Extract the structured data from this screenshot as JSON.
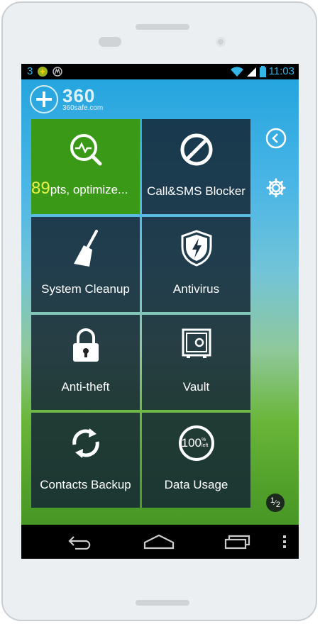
{
  "status_bar": {
    "notification_count": "3",
    "time": "11:03"
  },
  "logo": {
    "number": "360",
    "site": "360safe.com"
  },
  "tiles": [
    {
      "score": "89",
      "label_suffix": "pts, optimize..."
    },
    {
      "label": "Call&SMS Blocker"
    },
    {
      "label": "System Cleanup"
    },
    {
      "label": "Antivirus"
    },
    {
      "label": "Anti-theft"
    },
    {
      "label": "Vault"
    },
    {
      "label": "Contacts Backup"
    },
    {
      "label": "Data Usage",
      "gauge": "100",
      "gauge_unit": "%",
      "gauge_sub": "left"
    }
  ],
  "pager": {
    "current": "1",
    "total": "2"
  },
  "icons": [
    "back-circle-icon",
    "gear-icon",
    "checkup-icon",
    "block-icon",
    "broom-icon",
    "shield-bolt-icon",
    "lock-icon",
    "safe-icon",
    "sync-icon",
    "data-gauge-icon"
  ],
  "colors": {
    "accent_green": "#3a9a17",
    "tile_dark": "#142634",
    "status_blue": "#33b5e5",
    "score_yellow": "#e8f24a"
  }
}
